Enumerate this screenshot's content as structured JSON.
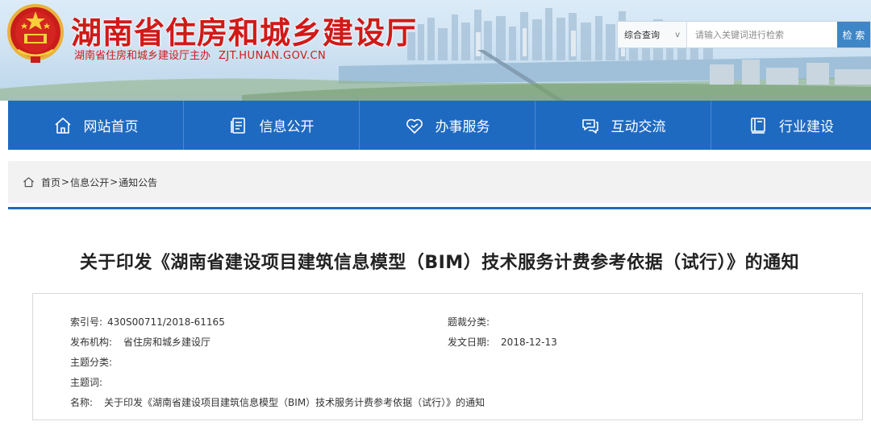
{
  "header": {
    "title": "湖南省住房和城乡建设厅",
    "subtitle": "湖南省住房和城乡建设厅主办",
    "domain": "ZJT.HUNAN.GOV.CN",
    "emblem_icon": "national-emblem-icon"
  },
  "search": {
    "scope": "综合查询",
    "scope_chevron": "v",
    "placeholder": "请输入关键词进行检索",
    "button_label": "检 索"
  },
  "nav": {
    "items": [
      {
        "label": "网站首页",
        "icon": "home-icon"
      },
      {
        "label": "信息公开",
        "icon": "document-icon"
      },
      {
        "label": "办事服务",
        "icon": "heart-icon"
      },
      {
        "label": "互动交流",
        "icon": "chat-icon"
      },
      {
        "label": "行业建设",
        "icon": "book-icon"
      }
    ]
  },
  "breadcrumb": {
    "icon": "home-icon",
    "items": [
      "首页",
      "信息公开",
      "通知公告"
    ],
    "separator": ">"
  },
  "article": {
    "title": "关于印发《湖南省建设项目建筑信息模型（BIM）技术服务计费参考依据（试行）》的通知",
    "meta": {
      "index_label": "索引号:",
      "index_value": "430S00711/2018-61165",
      "category_label": "题裁分类:",
      "category_value": "",
      "publisher_label": "发布机构:",
      "publisher_value": "省住房和城乡建设厅",
      "date_label": "发文日期:",
      "date_value": "2018-12-13",
      "topic_label": "主题分类:",
      "topic_value": "",
      "keywords_label": "主题词:",
      "keywords_value": "",
      "name_label": "名称:",
      "name_value": "关于印发《湖南省建设项目建筑信息模型（BIM）技术服务计费参考依据（试行）》的通知"
    }
  },
  "colors": {
    "brand_red": "#d01a18",
    "nav_blue": "#1f6ac1",
    "search_blue": "#3f86c6"
  }
}
